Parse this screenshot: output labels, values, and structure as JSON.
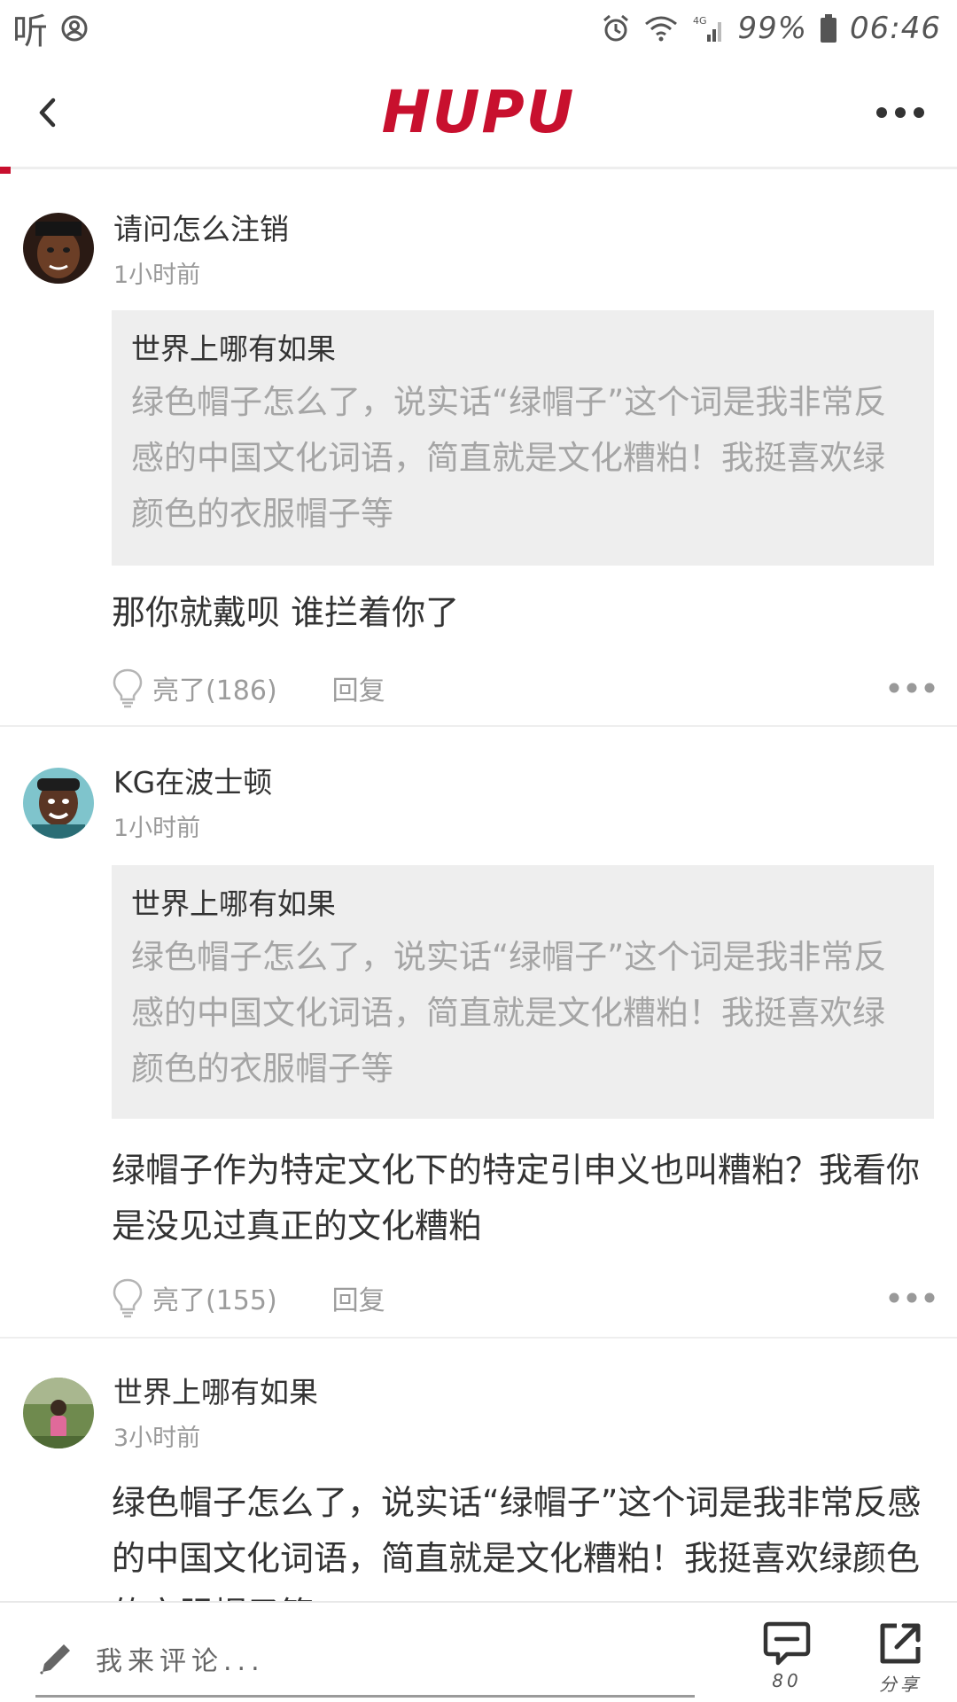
{
  "status_bar": {
    "app_glyph": "听",
    "battery": "99%",
    "time": "06:46",
    "network": "4G"
  },
  "header": {
    "logo": "HUPU"
  },
  "comments": [
    {
      "username": "请问怎么注销",
      "time": "1小时前",
      "quote": {
        "author": "世界上哪有如果",
        "text": "绿色帽子怎么了，说实话“绿帽子”这个词是我非常反感的中国文化词语，简直就是文化糟粕！我挺喜欢绿颜色的衣服帽子等"
      },
      "text": "那你就戴呗 谁拦着你了",
      "light_label": "亮了(186)",
      "reply_label": "回复"
    },
    {
      "username": "KG在波士顿",
      "time": "1小时前",
      "quote": {
        "author": "世界上哪有如果",
        "text": "绿色帽子怎么了，说实话“绿帽子”这个词是我非常反感的中国文化词语，简直就是文化糟粕！我挺喜欢绿颜色的衣服帽子等"
      },
      "text": "绿帽子作为特定文化下的特定引申义也叫糟粕？我看你是没见过真正的文化糟粕",
      "light_label": "亮了(155)",
      "reply_label": "回复"
    },
    {
      "username": "世界上哪有如果",
      "time": "3小时前",
      "text": "绿色帽子怎么了，说实话“绿帽子”这个词是我非常反感的中国文化词语，简直就是文化糟粕！我挺喜欢绿颜色的衣服帽子等"
    }
  ],
  "bottom_bar": {
    "input_placeholder": "我来评论...",
    "comment_count": "80",
    "share_label": "分享"
  },
  "icons": {
    "back": "chevron-left-icon",
    "more": "more-dots-icon",
    "light": "lightbulb-icon",
    "pencil": "pencil-icon",
    "comment": "comment-bubble-icon",
    "share": "share-icon"
  },
  "colors": {
    "brand_red": "#c8102e",
    "quote_bg": "#eeeeee",
    "muted_text": "#a5a5a5"
  }
}
